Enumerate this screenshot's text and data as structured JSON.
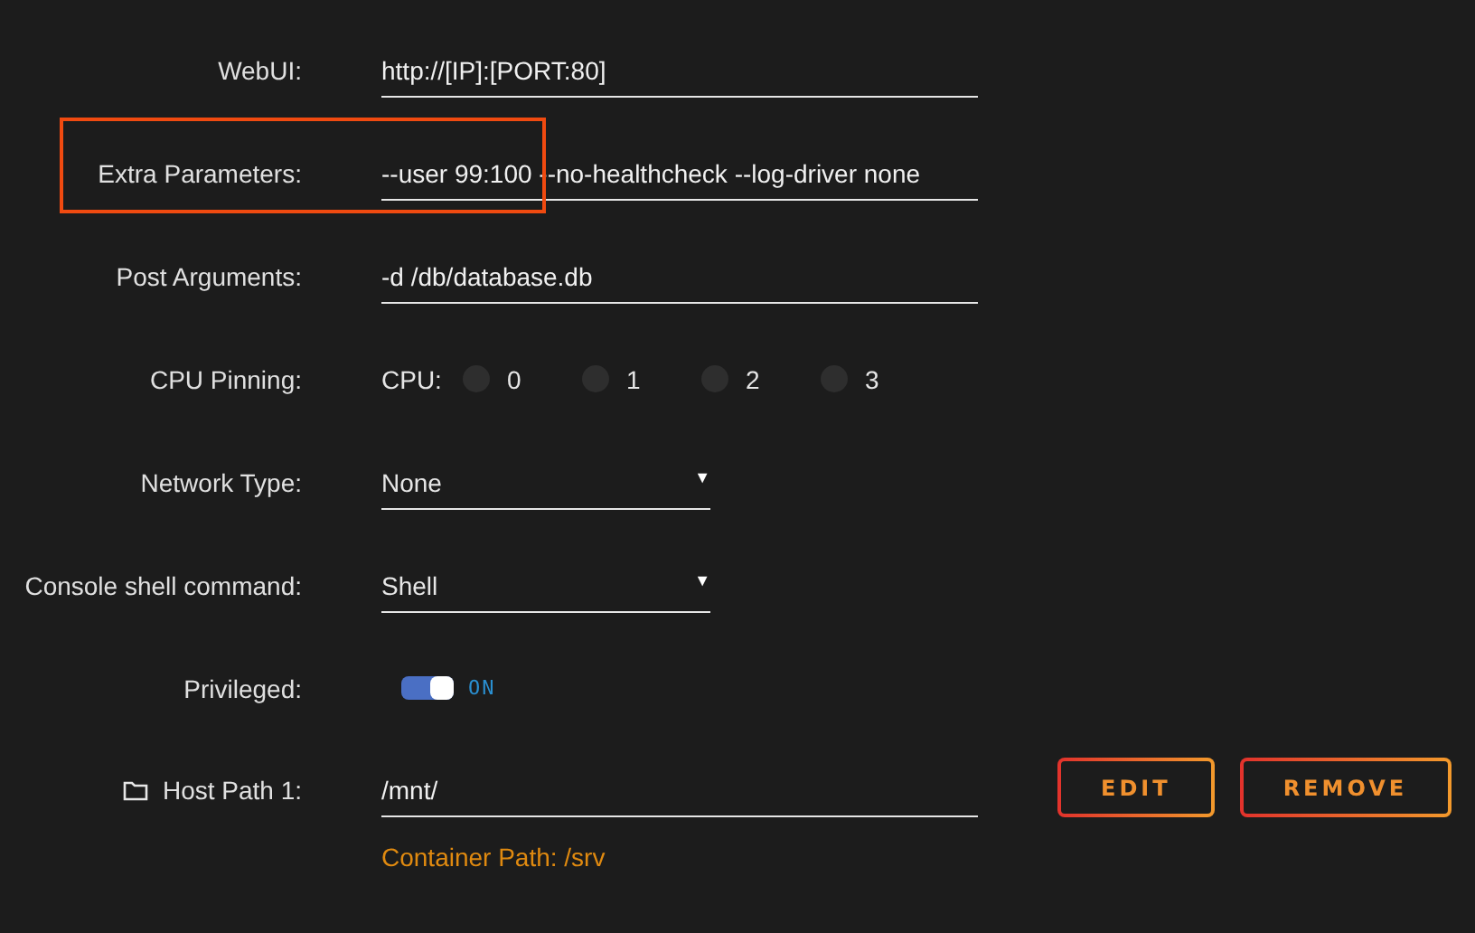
{
  "fields": [
    {
      "kind": "text",
      "label": "WebUI:",
      "value": "http://[IP]:[PORT:80]",
      "highlighted": false
    },
    {
      "kind": "text",
      "label": "Extra Parameters:",
      "value": "--user 99:100 --no-healthcheck --log-driver none",
      "highlighted": true
    },
    {
      "kind": "text",
      "label": "Post Arguments:",
      "value": "-d /db/database.db",
      "highlighted": false
    },
    {
      "kind": "cpu",
      "label": "CPU Pinning:",
      "prefix": "CPU:",
      "cores": [
        {
          "label": "0",
          "checked": false
        },
        {
          "label": "1",
          "checked": false
        },
        {
          "label": "2",
          "checked": false
        },
        {
          "label": "3",
          "checked": false
        }
      ]
    },
    {
      "kind": "select",
      "label": "Network Type:",
      "value": "None",
      "caret": "▼"
    },
    {
      "kind": "select",
      "label": "Console shell command:",
      "value": "Shell",
      "caret": "▼"
    },
    {
      "kind": "toggle",
      "label": "Privileged:",
      "on": true,
      "state_text": "ON"
    },
    {
      "kind": "path",
      "label": "Host Path 1:",
      "value": "/mnt/",
      "note": "Container Path: /srv",
      "buttons": [
        "EDIT",
        "REMOVE"
      ]
    }
  ]
}
